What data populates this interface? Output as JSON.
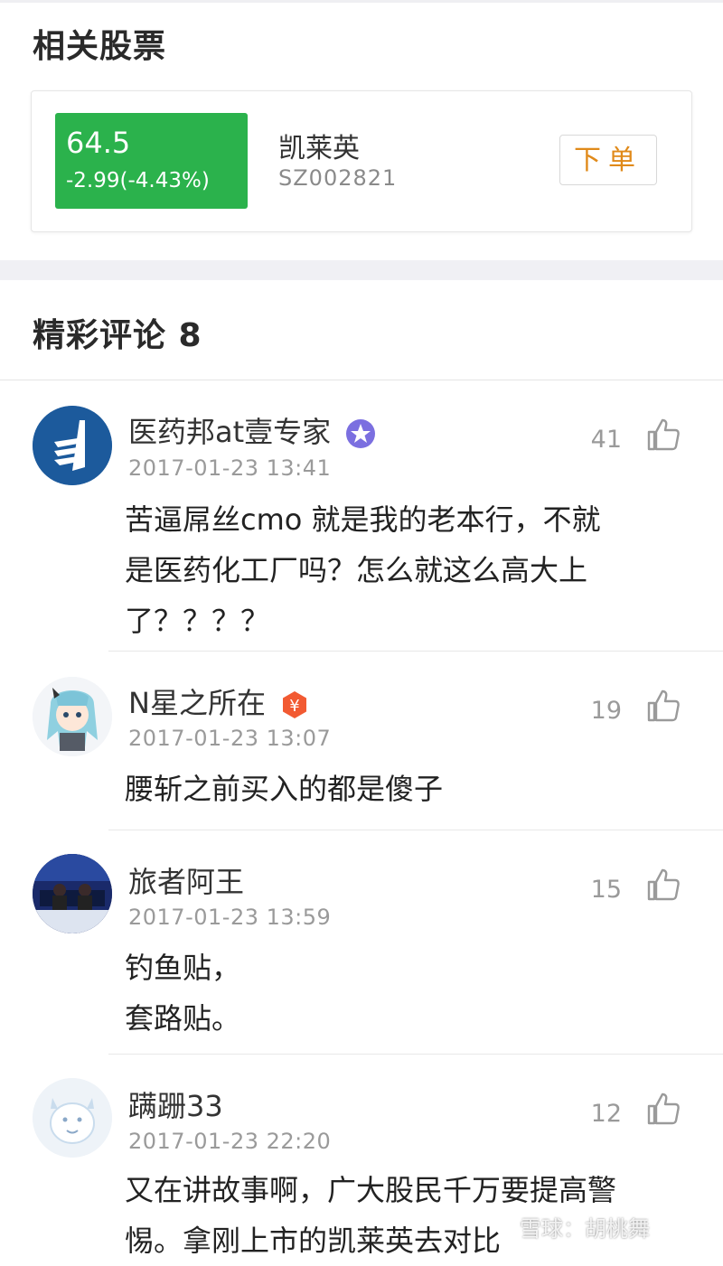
{
  "related_stocks": {
    "title": "相关股票",
    "stock": {
      "price": "64.5",
      "change": "-2.99(-4.43%)",
      "name": "凯莱英",
      "code": "SZ002821",
      "order_label": "下单",
      "price_box_color": "#2bb24c"
    }
  },
  "comments_section": {
    "title": "精彩评论 8",
    "comments": [
      {
        "user": "医药邦at壹专家",
        "badge_icon": "purple-star-badge-icon",
        "time": "2017-01-23 13:41",
        "likes": "41",
        "text": "苦逼屌丝cmo 就是我的老本行，不就\n是医药化工厂吗？怎么就这么高大上\n了？？？？"
      },
      {
        "user": "N星之所在",
        "badge_icon": "yen-badge-icon",
        "time": "2017-01-23 13:07",
        "likes": "19",
        "text": "腰斩之前买入的都是傻子"
      },
      {
        "user": "旅者阿王",
        "time": "2017-01-23 13:59",
        "likes": "15",
        "text": "钓鱼贴，\n套路贴。"
      },
      {
        "user": "蹒跚33",
        "time": "2017-01-23 22:20",
        "likes": "12",
        "text": "又在讲故事啊，广大股民千万要提高警\n惕。拿刚上市的凯莱英去对比"
      }
    ]
  },
  "watermark": "雪球：胡桃舞"
}
